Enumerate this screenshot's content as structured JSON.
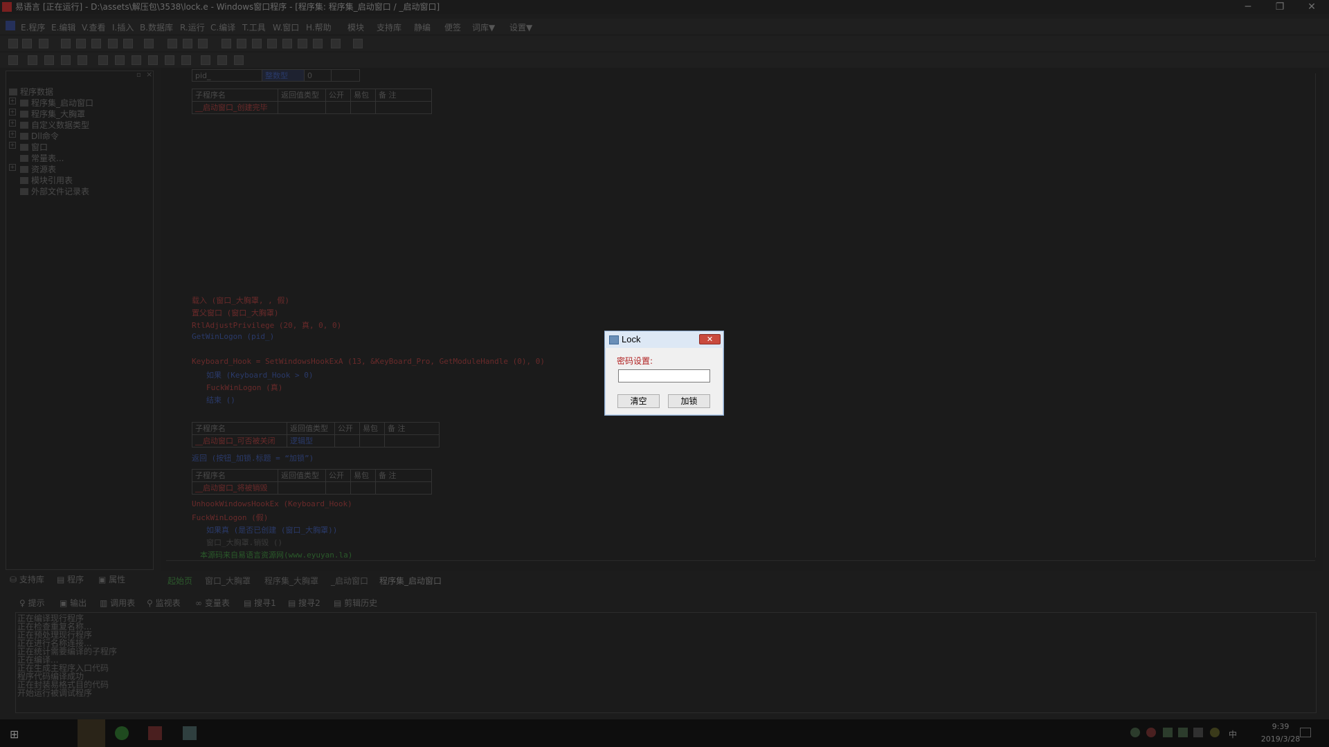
{
  "window": {
    "title": "易语言 [正在运行] - D:\\assets\\解压包\\3538\\lock.e - Windows窗口程序 - [程序集: 程序集_启动窗口 / _启动窗口]",
    "minimize": "─",
    "restore": "❐",
    "close": "✕"
  },
  "menu": [
    "E.程序",
    "E.编辑",
    "V.查看",
    "I.插入",
    "B.数据库",
    "R.运行",
    "C.编译",
    "T.工具",
    "W.窗口",
    "H.帮助",
    "模块",
    "支持库",
    "静编",
    "便签",
    "词库▼",
    "设置▼"
  ],
  "tree": {
    "root": "程序数据",
    "items": [
      "程序集_启动窗口",
      "程序集_大胸罩",
      "自定义数据类型",
      "Dll命令",
      "窗口",
      "常量表...",
      "资源表",
      "模块引用表",
      "外部文件记录表"
    ]
  },
  "left_tabs": [
    "支持库",
    "程序",
    "属性"
  ],
  "code": {
    "var_row": {
      "name": "pid_",
      "type": "整数型",
      "value": "0"
    },
    "sub_headers": [
      "子程序名",
      "返回值类型",
      "公开",
      "易包",
      "备 注"
    ],
    "sub1": "__启动窗口_创建完毕",
    "lines1": [
      "载入 (窗口_大胸罩, , 假)",
      "置父窗口 (窗口_大胸罩)",
      "RtlAdjustPrivilege (20, 真, 0, 0)",
      "GetWinLogon (pid_)",
      "Keyboard_Hook = SetWindowsHookExA (13, &KeyBoard_Pro, GetModuleHandle (0), 0)",
      "如果 (Keyboard_Hook > 0)",
      "FuckWinLogon (真)",
      "结束 ()"
    ],
    "sub2": "__启动窗口_可否被关闭",
    "sub2_type": "逻辑型",
    "line2": "返回 (按钮_加锁.标题 = “加锁”)",
    "sub3": "__启动窗口_将被销毁",
    "lines3": [
      "UnhookWindowsHookEx (Keyboard_Hook)",
      "FuckWinLogon (假)",
      "如果真 (是否已创建 (窗口_大胸罩))",
      "窗口_大胸罩.销毁 ()",
      "本源码来自易语言资源网(www.eyuyan.la)"
    ]
  },
  "editor_tabs": [
    "起始页",
    "窗口_大胸罩",
    "程序集_大胸罩",
    "_启动窗口",
    "程序集_启动窗口"
  ],
  "output_tabs": [
    "提示",
    "输出",
    "调用表",
    "监视表",
    "变量表",
    "搜寻1",
    "搜寻2",
    "剪辑历史"
  ],
  "output_lines": [
    "正在编译现行程序",
    "正在检查重复名称...",
    "正在预处理现行程序",
    "正在进行名称连接...",
    "正在统计需要编译的子程序",
    "正在编译...",
    "正在生成主程序入口代码",
    "程序代码编译成功",
    "正在封装易格式目的代码",
    "开始运行被调试程序"
  ],
  "dialog": {
    "title": "Lock",
    "close": "✕",
    "label": "密码设置:",
    "input_value": "",
    "clear_button": "清空",
    "lock_button": "加锁"
  },
  "taskbar": {
    "time": "9:39",
    "date": "2019/3/28",
    "ime": "中"
  }
}
